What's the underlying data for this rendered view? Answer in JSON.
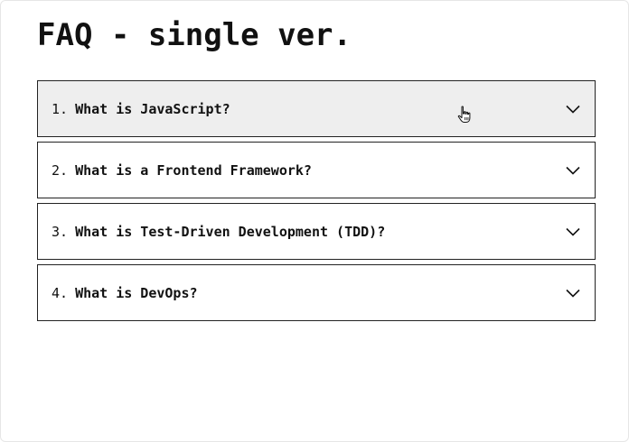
{
  "header": {
    "title": "FAQ - single ver."
  },
  "faq": {
    "items": [
      {
        "number": "1.",
        "question": "What is JavaScript?",
        "icon": "chevron-down-icon",
        "state": "hovered"
      },
      {
        "number": "2.",
        "question": "What is a Frontend Framework?",
        "icon": "chevron-down-icon",
        "state": "collapsed"
      },
      {
        "number": "3.",
        "question": "What is Test-Driven Development (TDD)?",
        "icon": "chevron-down-icon",
        "state": "collapsed"
      },
      {
        "number": "4.",
        "question": "What is DevOps?",
        "icon": "chevron-down-icon",
        "state": "collapsed"
      }
    ]
  },
  "colors": {
    "text": "#111111",
    "border": "#222222",
    "hover_background": "#eeeeee",
    "background": "#ffffff"
  },
  "cursor": {
    "icon": "hand-pointer-icon"
  }
}
